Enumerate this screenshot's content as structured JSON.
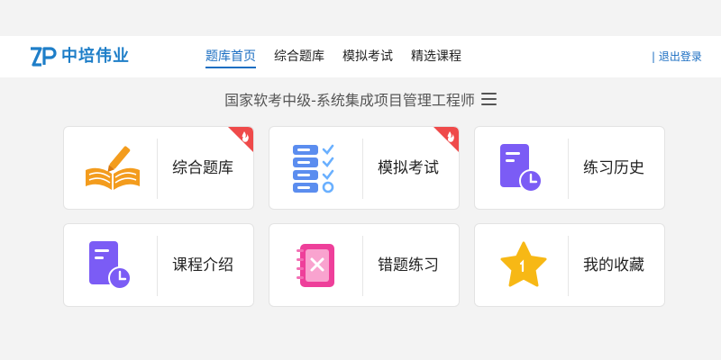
{
  "brand": {
    "name": "中培伟业",
    "mark": "ZP"
  },
  "nav": {
    "links": [
      {
        "label": "题库首页",
        "active": true
      },
      {
        "label": "综合题库",
        "active": false
      },
      {
        "label": "模拟考试",
        "active": false
      },
      {
        "label": "精选课程",
        "active": false
      }
    ],
    "logout": "| 退出登录"
  },
  "page": {
    "title": "国家软考中级-系统集成项目管理工程师"
  },
  "cards": [
    {
      "label": "综合题库",
      "icon": "open-book-pen-icon",
      "hot": true
    },
    {
      "label": "模拟考试",
      "icon": "checklist-icon",
      "hot": true
    },
    {
      "label": "练习历史",
      "icon": "document-clock-icon",
      "hot": false
    },
    {
      "label": "课程介绍",
      "icon": "document-clock-icon",
      "hot": false
    },
    {
      "label": "错题练习",
      "icon": "notebook-x-icon",
      "hot": false
    },
    {
      "label": "我的收藏",
      "icon": "star-icon",
      "hot": false
    }
  ],
  "colors": {
    "accent": "#1b6ec2",
    "hot_badge": "#ef4a4a",
    "book_orange": "#f39c1d",
    "purple": "#7b5cf5",
    "pink": "#ee3f9a",
    "star": "#f7b815"
  }
}
